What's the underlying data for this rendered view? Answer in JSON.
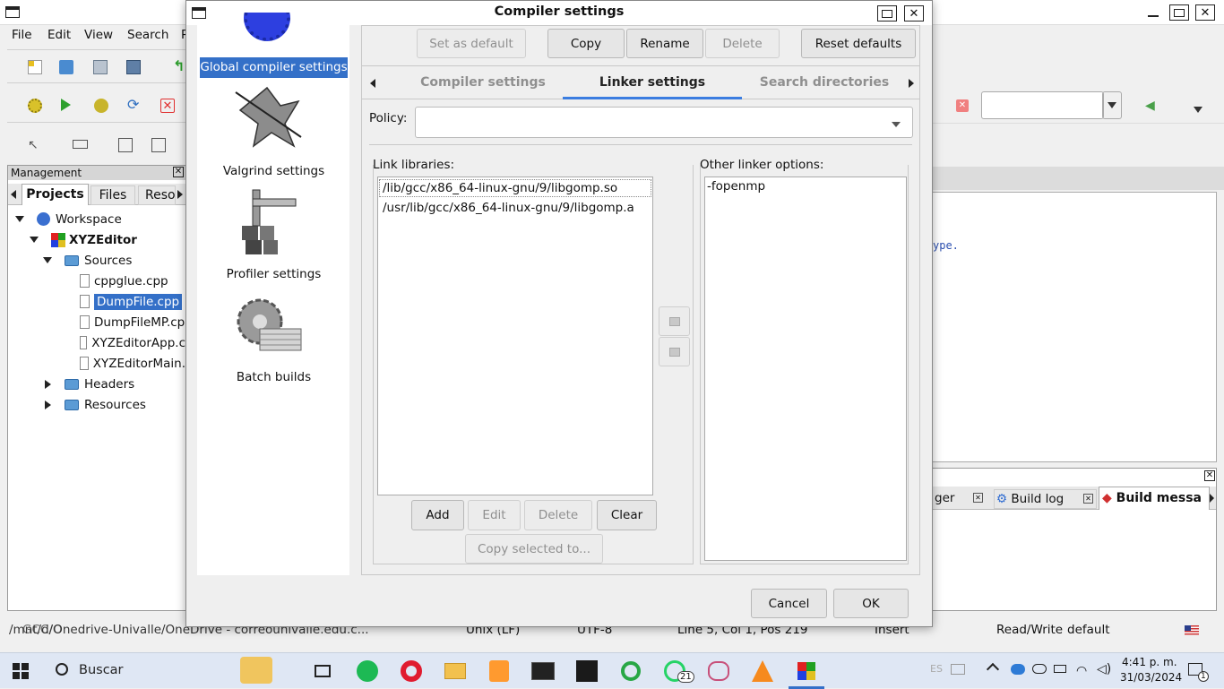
{
  "bg_window": {
    "menu": [
      "File",
      "Edit",
      "View",
      "Search",
      "P"
    ],
    "management_label": "Management",
    "panel_tabs": [
      "Projects",
      "Files",
      "Reso"
    ],
    "tree": {
      "workspace": "Workspace",
      "project": "XYZEditor",
      "sources": "Sources",
      "files": [
        "cppglue.cpp",
        "DumpFile.cpp",
        "DumpFileMP.cp",
        "XYZEditorApp.c",
        "XYZEditorMain."
      ],
      "headers": "Headers",
      "resources": "Resources"
    },
    "editor_snippet": "ype.",
    "log_tabs": [
      "ger",
      "Build log",
      "Build messa"
    ],
    "status": {
      "path": "/mnt/d/Onedrive-Univalle/OneDrive - correounivalle.edu.c...",
      "eol": "Unix (LF)",
      "encoding": "UTF-8",
      "position": "Line 5, Col 1, Pos 219",
      "mode": "Insert",
      "rw": "Read/Write",
      "profile": "default",
      "gcc": "GCC/O"
    }
  },
  "dialog": {
    "title": "Compiler settings",
    "sidebar": [
      {
        "label": "Global compiler settings",
        "icon": "gear-icon",
        "selected": true
      },
      {
        "label": "Valgrind settings",
        "icon": "knight-icon",
        "selected": false
      },
      {
        "label": "Profiler settings",
        "icon": "caliper-icon",
        "selected": false
      },
      {
        "label": "Batch builds",
        "icon": "gear-stack-icon",
        "selected": false
      }
    ],
    "top_buttons": {
      "set_default": "Set as default",
      "copy": "Copy",
      "rename": "Rename",
      "delete": "Delete",
      "reset": "Reset defaults"
    },
    "tabs": [
      "Compiler settings",
      "Linker settings",
      "Search directories"
    ],
    "active_tab": "Linker settings",
    "policy_label": "Policy:",
    "policy_value": "",
    "link_libraries_label": "Link libraries:",
    "link_libraries": [
      "/lib/gcc/x86_64-linux-gnu/9/libgomp.so",
      "/usr/lib/gcc/x86_64-linux-gnu/9/libgomp.a"
    ],
    "other_options_label": "Other linker options:",
    "other_options": "-fopenmp",
    "lib_buttons": {
      "add": "Add",
      "edit": "Edit",
      "delete": "Delete",
      "clear": "Clear",
      "copy_selected": "Copy selected to..."
    },
    "cancel": "Cancel",
    "ok": "OK"
  },
  "taskbar": {
    "search_placeholder": "Buscar",
    "time": "4:41 p. m.",
    "date": "31/03/2024",
    "whatsapp_badge": "21",
    "notification_badge": "1",
    "lang": "ES"
  },
  "colors": {
    "accent": "#3470c8",
    "tab_underline": "#3b7de0",
    "taskbar_bg": "#dfe7f4"
  }
}
